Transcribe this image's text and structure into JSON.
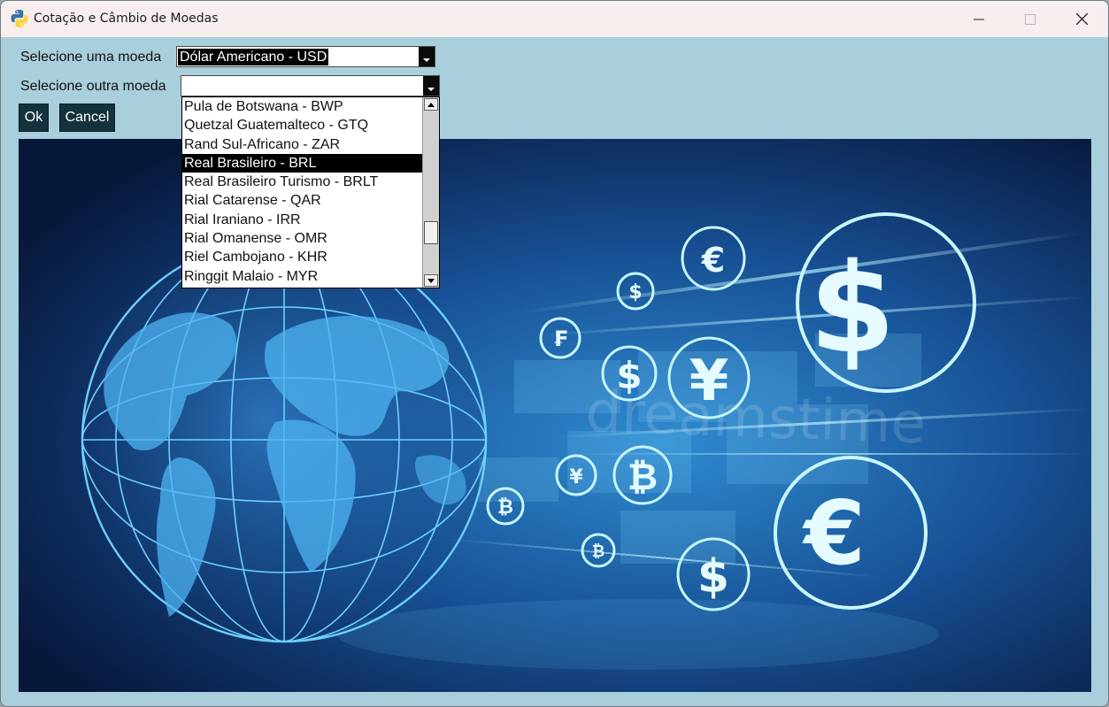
{
  "window": {
    "title": "Cotação e Câmbio de Moedas",
    "controls": {
      "minimize_icon": "minimize-icon",
      "maximize_icon": "maximize-icon",
      "close_icon": "close-icon"
    }
  },
  "form": {
    "first_label": "Selecione uma moeda",
    "first_value": "Dólar Americano - USD",
    "second_label": "Selecione outra moeda",
    "second_value": ""
  },
  "buttons": {
    "ok": "Ok",
    "cancel": "Cancel"
  },
  "dropdown": {
    "items": [
      "Pula de Botswana - BWP",
      "Quetzal Guatemalteco - GTQ",
      "Rand Sul-Africano - ZAR",
      "Real Brasileiro - BRL",
      "Real Brasileiro Turismo - BRLT",
      "Rial Catarense - QAR",
      "Rial Iraniano - IRR",
      "Rial Omanense - OMR",
      "Riel Cambojano - KHR",
      "Ringgit Malaio - MYR"
    ],
    "highlighted": "Real Brasileiro - BRL"
  },
  "hero": {
    "watermark": "dreamstime",
    "symbols": [
      "$",
      "€",
      "¥",
      "₿",
      "₣"
    ],
    "colors": {
      "deep": "#0a1f45",
      "glow": "#7ee6ff",
      "globe": "#3aa6e8"
    }
  }
}
